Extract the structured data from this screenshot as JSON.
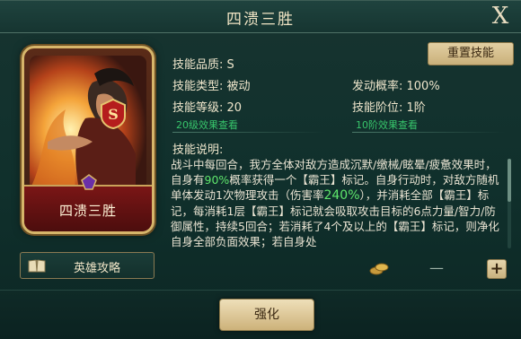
{
  "window": {
    "title": "四溃三胜",
    "close_label": "X"
  },
  "card": {
    "name": "四溃三胜",
    "grade": "S"
  },
  "guide_button": {
    "label": "英雄攻略"
  },
  "reset_button": {
    "label": "重置技能"
  },
  "skill": {
    "quality_label": "技能品质: S",
    "type_label": "技能类型: 被动",
    "level_label": "技能等级: 20",
    "level_effect_link": "20级效果查看",
    "rate_label": "发动概率: 100%",
    "tier_label": "技能阶位: 1阶",
    "tier_effect_link": "10阶效果查看",
    "desc_title": "技能说明:",
    "desc_parts": {
      "p1": "战斗中每回合，我方全体对敌方造成沉默/缴械/眩晕/疲惫效果时，自身有",
      "p1_hl": "90%",
      "p2": "概率获得一个【霸王】标记。自身行动时，对敌方随机单体发动1次物理攻击（伤害率",
      "p2_hl": "240%",
      "p3": "），并消耗全部【霸王】标记，每消耗1层【霸王】标记就会吸取攻击目标的6点力量/智力/防御属性，持续5回合；若消耗了4个及以上的【霸王】标记，则净化自身全部负面效果；若自身处"
    }
  },
  "controls": {
    "minus_label": "—",
    "plus_label": "+"
  },
  "upgrade_button": {
    "label": "强化"
  },
  "colors": {
    "accent_green": "#5fe66c",
    "link_green": "#37c56b",
    "gold_button": "#d9c28f",
    "panel_bg": "#12302c"
  },
  "icons": {
    "close": "close-icon",
    "book": "book-icon",
    "coin": "coin-icon",
    "gem": "gem-icon"
  }
}
